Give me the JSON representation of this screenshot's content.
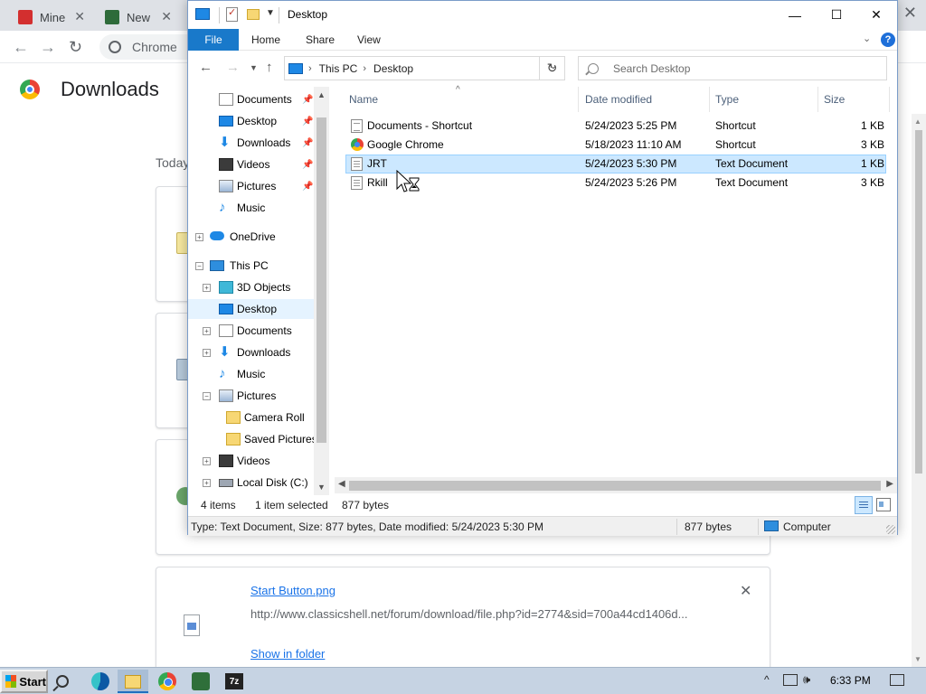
{
  "chrome": {
    "tabs": [
      {
        "label": "Mine"
      },
      {
        "label": "New"
      }
    ],
    "omnibox_text": "Chrome",
    "page_title": "Downloads",
    "section_label": "Today",
    "download_item": {
      "file_name": "Start Button.png",
      "url": "http://www.classicshell.net/forum/download/file.php?id=2774&sid=700a44cd1406d...",
      "show_in_folder": "Show in folder"
    }
  },
  "explorer": {
    "title": "Desktop",
    "ribbon_tabs": [
      "File",
      "Home",
      "Share",
      "View"
    ],
    "breadcrumb": [
      "This PC",
      "Desktop"
    ],
    "search_placeholder": "Search Desktop",
    "nav_pane": [
      {
        "label": "Documents",
        "icon": "documents-icon",
        "pinned": true
      },
      {
        "label": "Desktop",
        "icon": "desktop-icon",
        "pinned": true
      },
      {
        "label": "Downloads",
        "icon": "downloads-icon",
        "pinned": true
      },
      {
        "label": "Videos",
        "icon": "videos-icon",
        "pinned": true
      },
      {
        "label": "Pictures",
        "icon": "pictures-icon",
        "pinned": true
      },
      {
        "label": "Music",
        "icon": "music-icon",
        "pinned": false
      },
      {
        "label": "OneDrive",
        "icon": "onedrive-icon"
      },
      {
        "label": "This PC",
        "icon": "this-pc-icon"
      },
      {
        "label": "3D Objects",
        "icon": "3d-objects-icon"
      },
      {
        "label": "Desktop",
        "icon": "desktop-icon",
        "selected": true
      },
      {
        "label": "Documents",
        "icon": "documents-icon"
      },
      {
        "label": "Downloads",
        "icon": "downloads-icon"
      },
      {
        "label": "Music",
        "icon": "music-icon"
      },
      {
        "label": "Pictures",
        "icon": "pictures-icon"
      },
      {
        "label": "Camera Roll",
        "icon": "folder-icon"
      },
      {
        "label": "Saved Pictures",
        "icon": "folder-icon"
      },
      {
        "label": "Videos",
        "icon": "videos-icon"
      },
      {
        "label": "Local Disk (C:)",
        "icon": "drive-icon"
      }
    ],
    "columns": [
      "Name",
      "Date modified",
      "Type",
      "Size"
    ],
    "files": [
      {
        "name": "Documents - Shortcut",
        "date": "5/24/2023 5:25 PM",
        "type": "Shortcut",
        "size": "1 KB",
        "icon": "shortcut-icon"
      },
      {
        "name": "Google Chrome",
        "date": "5/18/2023 11:10 AM",
        "type": "Shortcut",
        "size": "3 KB",
        "icon": "chrome-icon"
      },
      {
        "name": "JRT",
        "date": "5/24/2023 5:30 PM",
        "type": "Text Document",
        "size": "1 KB",
        "icon": "text-document-icon",
        "selected": true
      },
      {
        "name": "Rkill",
        "date": "5/24/2023 5:26 PM",
        "type": "Text Document",
        "size": "3 KB",
        "icon": "text-document-icon"
      }
    ],
    "status": {
      "item_count": "4 items",
      "selection": "1 item selected",
      "selection_size": "877 bytes",
      "details": "Type: Text Document, Size: 877 bytes, Date modified: 5/24/2023 5:30 PM",
      "bytes": "877 bytes",
      "location": "Computer"
    }
  },
  "taskbar": {
    "start_label": "Start",
    "app_7z": "7z",
    "clock": "6:33 PM"
  },
  "colors": {
    "ribbon_file_tab": "#1979ca",
    "selection_fill": "#cce8ff",
    "taskbar": "#c6d3e3",
    "link": "#1a73e8"
  }
}
